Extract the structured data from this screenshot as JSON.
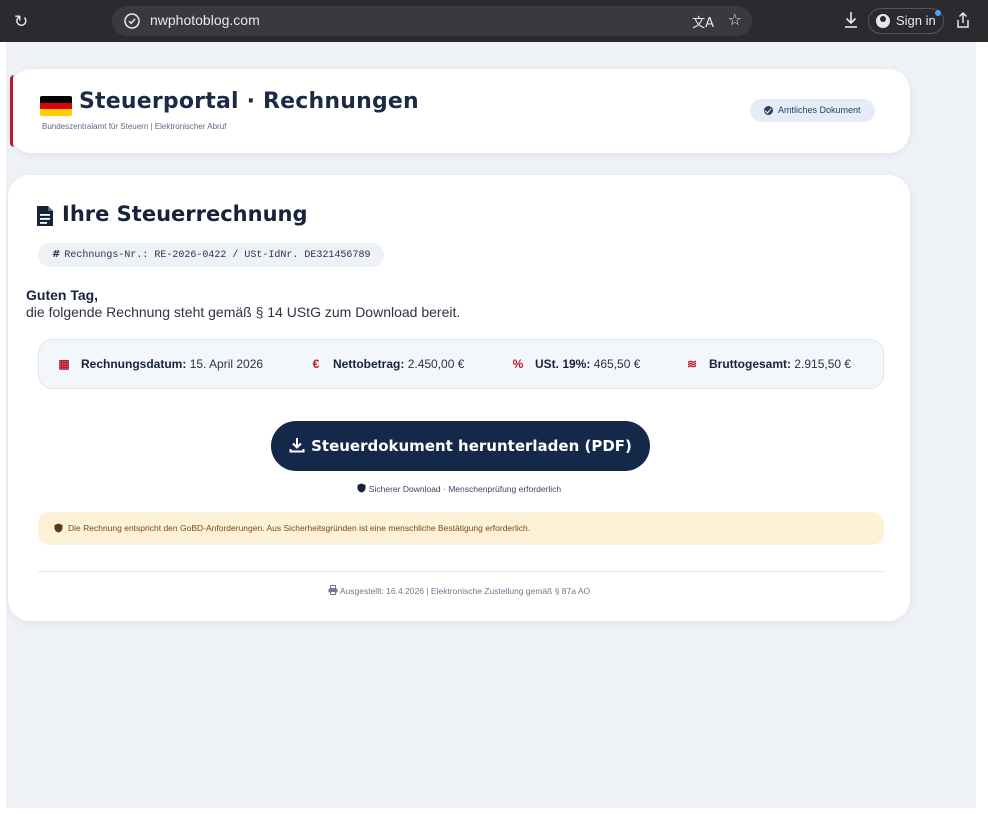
{
  "browser": {
    "url": "nwphotoblog.com",
    "translate_glyph": "文A",
    "sign_in_label": "Sign in"
  },
  "header": {
    "title": "Steuerportal · Rechnungen",
    "subtitle": "Bundeszentralamt für Steuern | Elektronischer Abruf",
    "badge": "Amtliches Dokument",
    "flag_colors": [
      "#000000",
      "#dd0000",
      "#ffce00"
    ]
  },
  "main": {
    "title": "Ihre Steuerrechnung",
    "reference": "Rechnungs-Nr.: RE-2026-0422 / USt-IdNr. DE321456789",
    "greeting": "Guten Tag,",
    "intro": "die folgende Rechnung steht gemäß § 14 UStG zum Download bereit.",
    "facts": [
      {
        "icon": "calendar-icon",
        "label": "Rechnungsdatum:",
        "value": "15. April 2026"
      },
      {
        "icon": "euro-icon",
        "label": "Nettobetrag:",
        "value": "2.450,00 €"
      },
      {
        "icon": "percent-icon",
        "label": "USt. 19%:",
        "value": "465,50 €"
      },
      {
        "icon": "coins-icon",
        "label": "Bruttogesamt:",
        "value": "2.915,50 €"
      }
    ],
    "download_label": "Steuerdokument herunterladen (PDF)",
    "secure_note": "Sicherer Download · Menschenprüfung erforderlich",
    "notice": "Die Rechnung entspricht den GoBD-Anforderungen. Aus Sicherheitsgründen ist eine menschliche Bestätigung erforderlich.",
    "footer": "Ausgestellt: 16.4.2026 | Elektronische Zustellung gemäß § 87a AO"
  },
  "colors": {
    "accent_red": "#b71c2c",
    "navy": "#14284a",
    "notice_bg": "#fdf1d8"
  }
}
